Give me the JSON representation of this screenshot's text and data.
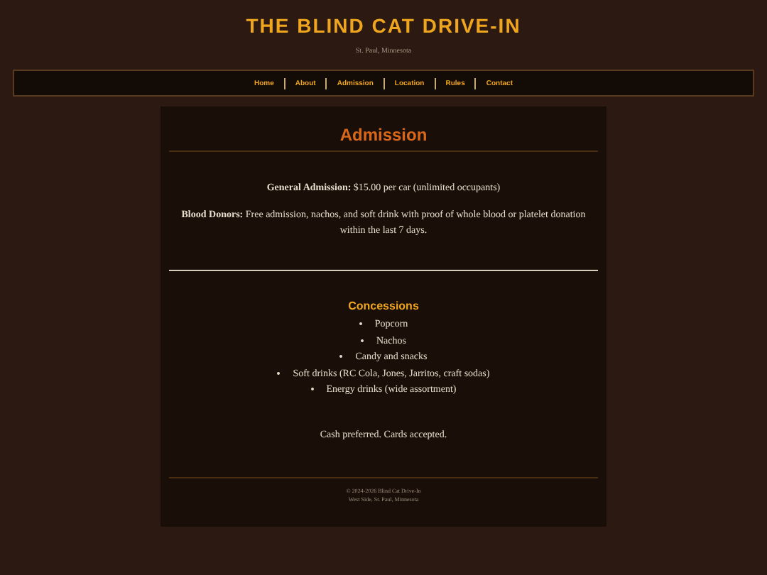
{
  "header": {
    "title": "THE BLIND CAT DRIVE-IN",
    "subtitle": "St. Paul, Minnesota"
  },
  "nav": [
    "Home",
    "About",
    "Admission",
    "Location",
    "Rules",
    "Contact"
  ],
  "main": {
    "heading": "Admission",
    "prices": [
      {
        "label": "General Admission:",
        "text": "$15.00 per car (unlimited occupants)"
      },
      {
        "label": "Blood Donors:",
        "text": "Free admission, nachos, and soft drink with proof of whole blood or platelet donation within the last 7 days."
      }
    ],
    "concessions": {
      "heading": "Concessions",
      "items": [
        "Popcorn",
        "Nachos",
        "Candy and snacks",
        "Soft drinks (RC Cola, Jones, Jarritos, craft sodas)",
        "Energy drinks (wide assortment)"
      ]
    },
    "payment_note": "Cash preferred. Cards accepted."
  },
  "footer": [
    "© 2024-2026 Blind Cat Drive-In",
    "West Side, St. Paul, Minnesota"
  ]
}
